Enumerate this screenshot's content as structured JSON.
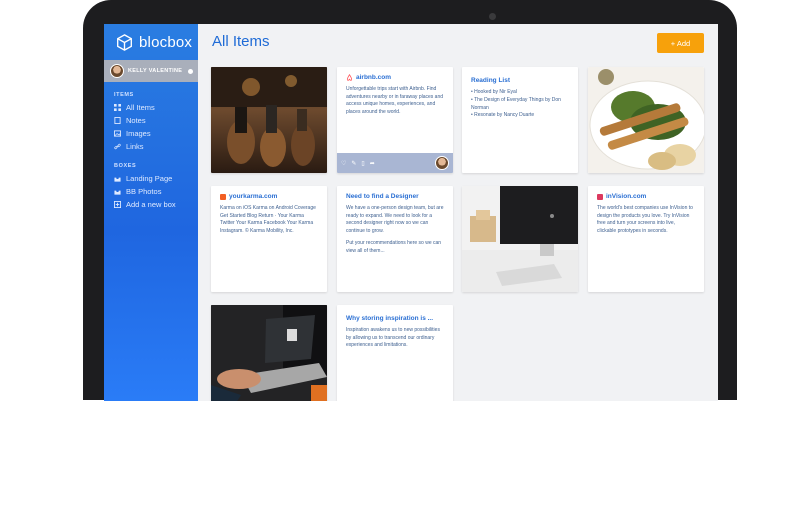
{
  "app": {
    "name": "blocbox",
    "user_name": "KELLY VALENTINE"
  },
  "sidebar": {
    "items_title": "ITEMS",
    "items": [
      {
        "label": "All Items",
        "icon": "grid-icon"
      },
      {
        "label": "Notes",
        "icon": "note-icon"
      },
      {
        "label": "Images",
        "icon": "image-icon"
      },
      {
        "label": "Links",
        "icon": "link-icon"
      }
    ],
    "boxes_title": "BOXES",
    "boxes": [
      {
        "label": "Landing Page",
        "icon": "box-icon"
      },
      {
        "label": "BB Photos",
        "icon": "box-icon"
      },
      {
        "label": "Add a new box",
        "icon": "plus-square-icon"
      }
    ]
  },
  "header": {
    "title": "All Items",
    "add_label": "+ Add"
  },
  "cards": {
    "airbnb": {
      "title": "airbnb.com",
      "text": "Unforgettable trips start with Airbnb. Find adventures nearby or in faraway places and access unique homes, experiences, and places around the world."
    },
    "reading": {
      "title": "Reading List",
      "bullets": [
        "Hooked by Nir Eyal",
        "The Design of Everyday Things by Don Norman",
        "Resonate by Nancy Duarte"
      ]
    },
    "yourkarma": {
      "title": "yourkarma.com",
      "text": "Karma on iOS Karma on Android Coverage Get Started Blog Return · Your Karma Twitter Your Karma Facebook Your Karma Instagram. © Karma Mobility, Inc."
    },
    "designer": {
      "title": "Need to find a Designer",
      "text1": "We have a one-person design team, but are ready to expand. We need to look for a second designer right now so we can continue to grow.",
      "text2": "Put your recommendations here so we can view all of them..."
    },
    "invision": {
      "title": "inVision.com",
      "text": "The world's best companies use InVision to design the products you love. Try InVision free and turn your screens into live, clickable prototypes in seconds."
    },
    "inspiration": {
      "title": "Why storing inspiration is ...",
      "text": "Inspiration awakens us to new possibilities by allowing us to transcend our ordinary experiences and limitations."
    }
  },
  "colors": {
    "accent": "#1f6bd6",
    "add_button": "#f7a10b",
    "sidebar": "#2a7de1"
  }
}
